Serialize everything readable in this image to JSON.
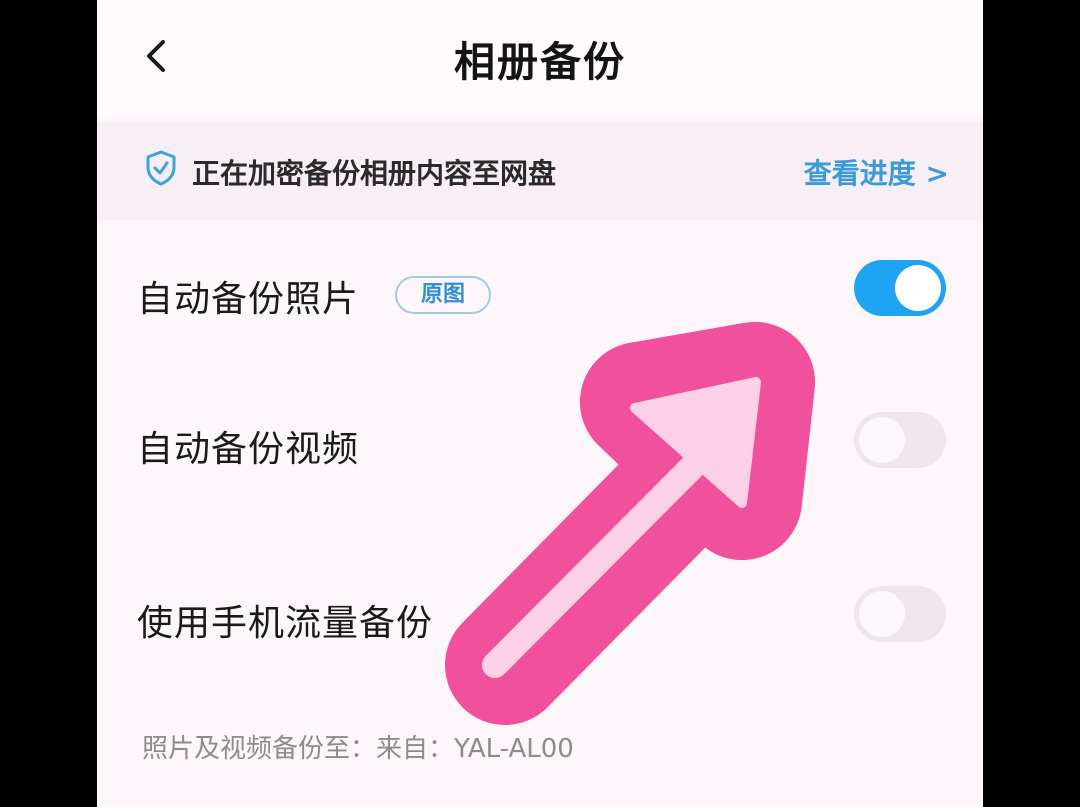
{
  "header": {
    "title": "相册备份",
    "back_icon": "chevron-left-icon"
  },
  "banner": {
    "icon": "shield-check-icon",
    "text": "正在加密备份相册内容至网盘",
    "link": "查看进度 >",
    "accent": "#3b9ad8"
  },
  "settings": {
    "photos": {
      "label": "自动备份照片",
      "badge": "原图",
      "enabled": true
    },
    "videos": {
      "label": "自动备份视频",
      "enabled": false
    },
    "mobile_data": {
      "label": "使用手机流量备份",
      "enabled": false
    }
  },
  "footer": {
    "text": "照片及视频备份至：来自：YAL-AL00"
  },
  "colors": {
    "toggle_on": "#1ea4f0",
    "arrow": "#f0509c",
    "arrow_inner": "#fcd0e6"
  },
  "overlay": {
    "icon": "arrow-up-right-icon"
  }
}
